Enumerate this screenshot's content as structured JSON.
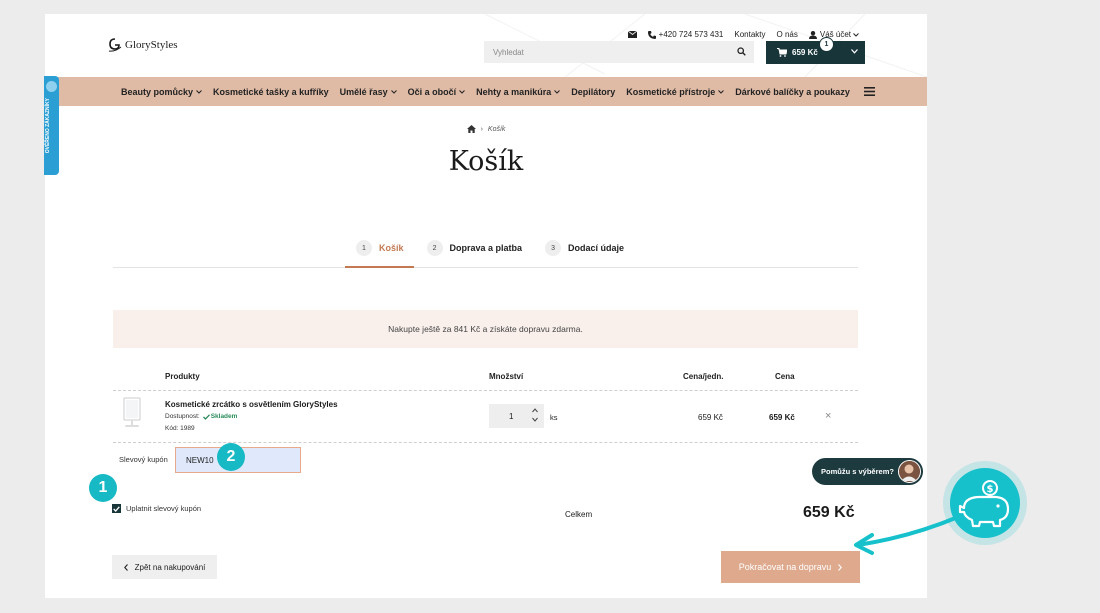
{
  "topbar": {
    "phone": "+420 724 573 431",
    "contacts": "Kontakty",
    "about": "O nás",
    "account": "Váš účet"
  },
  "logo": {
    "text": "GloryStyles"
  },
  "search": {
    "placeholder": "Vyhledat"
  },
  "cart": {
    "total": "659 Kč",
    "count": "1"
  },
  "nav": {
    "items": [
      "Beauty pomůcky",
      "Kosmetické tašky a kufříky",
      "Umělé řasy",
      "Oči a obočí",
      "Nehty a manikúra",
      "Depilátory",
      "Kosmetické přístroje",
      "Dárkové balíčky a poukazy"
    ]
  },
  "breadcrumb": {
    "current": "Košík"
  },
  "page_title": "Košík",
  "steps": [
    {
      "num": "1",
      "label": "Košík"
    },
    {
      "num": "2",
      "label": "Doprava a platba"
    },
    {
      "num": "3",
      "label": "Dodací údaje"
    }
  ],
  "shipping_info": "Nakupte ještě za 841 Kč a získáte dopravu zdarma.",
  "table": {
    "headers": {
      "product": "Produkty",
      "qty": "Množství",
      "unit_price": "Cena/jedn.",
      "price": "Cena"
    },
    "row": {
      "name": "Kosmetické zrcátko s osvětlením GloryStyles",
      "availability_label": "Dostupnost:",
      "availability_value": "Skladem",
      "code": "Kód: 1989",
      "quantity": "1",
      "unit": "ks",
      "unit_price": "659 Kč",
      "price": "659 Kč",
      "remove": "×"
    }
  },
  "coupon": {
    "label": "Slevový kupón",
    "value": "NEW10",
    "apply_label": "Uplatnit slevový kupón"
  },
  "summary": {
    "label": "Celkem",
    "total": "659 Kč"
  },
  "buttons": {
    "back": "Zpět na nakupování",
    "continue": "Pokračovat na dopravu"
  },
  "chat": {
    "label": "Pomůžu s výběrem?"
  },
  "verified_badge": "OVĚŘENO ZÁKAZNÍKY",
  "annotations": {
    "one": "1",
    "two": "2"
  },
  "colors": {
    "accent": "#c37a52",
    "nav_bg": "#dfbba6",
    "dark": "#18353a",
    "cta": "#dea98d",
    "annotation": "#16b9c4"
  }
}
